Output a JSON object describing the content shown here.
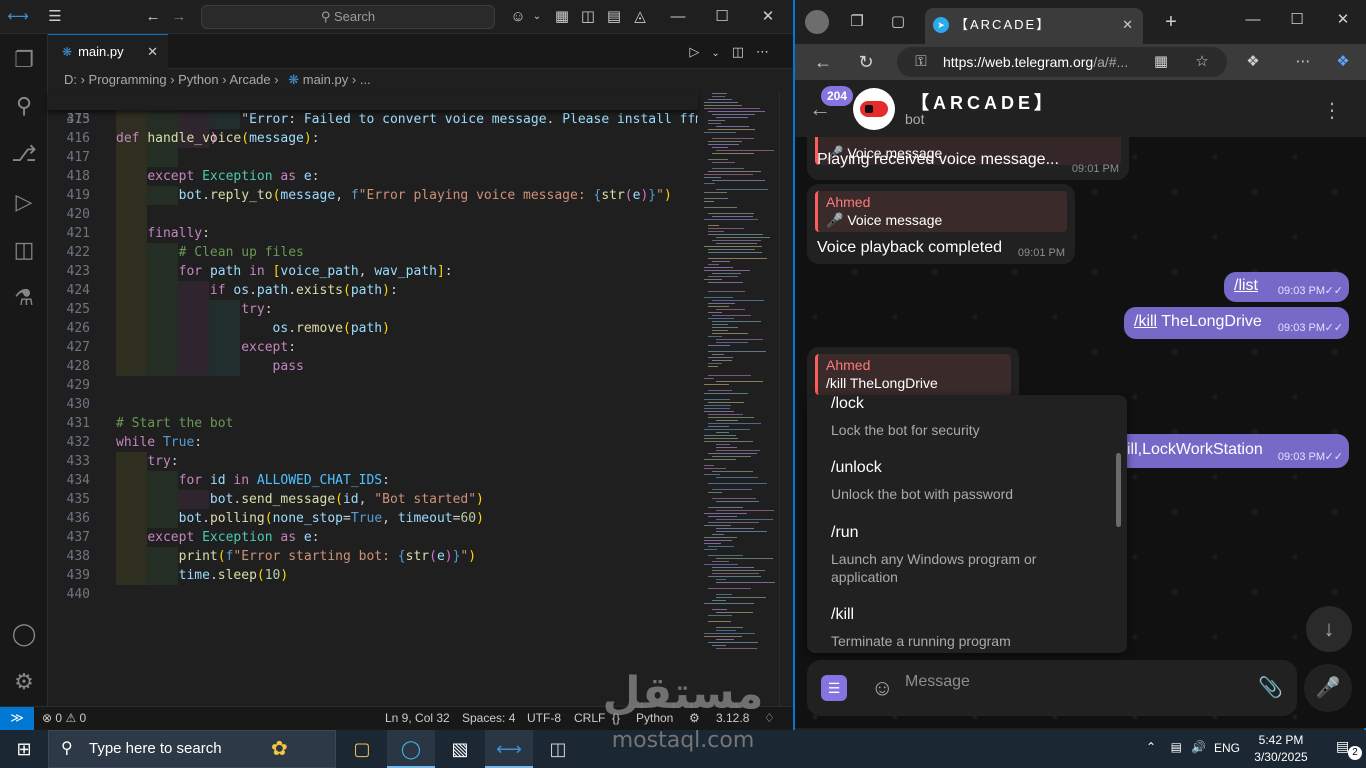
{
  "vscode": {
    "search_placeholder": "Search",
    "tab_label": "main.py",
    "breadcrumb": "D: › Programming › Python › Arcade ›",
    "breadcrumb_file": "main.py",
    "breadcrumb_tail": "› ...",
    "sticky_line": {
      "number": "373",
      "text": "def handle_voice(message):"
    },
    "status": {
      "problems": "0",
      "warnings": "0",
      "cursor": "Ln 9, Col 32",
      "spaces": "Spaces: 4",
      "encoding": "UTF-8",
      "eol": "CRLF",
      "language": "Python",
      "interpreter": "3.12.8"
    },
    "lines": [
      {
        "n": "415",
        "t": "                \"Error: Failed to convert voice message. Please install ffm"
      },
      {
        "n": "416",
        "t": "            )"
      },
      {
        "n": "417",
        "t": ""
      },
      {
        "n": "418",
        "t": "    except Exception as e:"
      },
      {
        "n": "419",
        "t": "        bot.reply_to(message, f\"Error playing voice message: {str(e)}\")"
      },
      {
        "n": "420",
        "t": ""
      },
      {
        "n": "421",
        "t": "    finally:"
      },
      {
        "n": "422",
        "t": "        # Clean up files"
      },
      {
        "n": "423",
        "t": "        for path in [voice_path, wav_path]:"
      },
      {
        "n": "424",
        "t": "            if os.path.exists(path):"
      },
      {
        "n": "425",
        "t": "                try:"
      },
      {
        "n": "426",
        "t": "                    os.remove(path)"
      },
      {
        "n": "427",
        "t": "                except:"
      },
      {
        "n": "428",
        "t": "                    pass"
      },
      {
        "n": "429",
        "t": ""
      },
      {
        "n": "430",
        "t": ""
      },
      {
        "n": "431",
        "t": "# Start the bot"
      },
      {
        "n": "432",
        "t": "while True:"
      },
      {
        "n": "433",
        "t": "    try:"
      },
      {
        "n": "434",
        "t": "        for id in ALLOWED_CHAT_IDS:"
      },
      {
        "n": "435",
        "t": "            bot.send_message(id, \"Bot started\")"
      },
      {
        "n": "436",
        "t": "        bot.polling(none_stop=True, timeout=60)"
      },
      {
        "n": "437",
        "t": "    except Exception as e:"
      },
      {
        "n": "438",
        "t": "        print(f\"Error starting bot: {str(e)}\")"
      },
      {
        "n": "439",
        "t": "        time.sleep(10)"
      },
      {
        "n": "440",
        "t": ""
      }
    ]
  },
  "browser": {
    "tab_title": "【ARCADE】",
    "url_domain": "https://web.telegram.org",
    "url_rest": "/a/#...",
    "chat": {
      "unread_badge": "204",
      "title": "【ARCADE】",
      "subtitle": "bot",
      "messages": [
        {
          "id": "m1",
          "reply_name": "",
          "reply_text": "🎤 Voice message",
          "text": "Playing received voice message...",
          "time": "09:01 PM"
        },
        {
          "id": "m2",
          "reply_name": "Ahmed",
          "reply_text": "🎤 Voice message",
          "text": "Voice playback completed",
          "time": "09:01 PM"
        },
        {
          "id": "m3",
          "text": "/list",
          "time": "09:03 PM"
        },
        {
          "id": "m4",
          "cmd": "/kill",
          "text": " TheLongDrive",
          "time": "09:03 PM"
        },
        {
          "id": "m5",
          "reply_name": "Ahmed",
          "reply_text": "/kill TheLongDrive"
        },
        {
          "id": "m6",
          "text": "ill,LockWorkStation",
          "time": "09:03 PM"
        }
      ],
      "commands": [
        {
          "name": "/lock",
          "desc": "Lock the bot for security"
        },
        {
          "name": "/unlock",
          "desc": "Unlock the bot with password"
        },
        {
          "name": "/run",
          "desc": "Launch any Windows program or application"
        },
        {
          "name": "/kill",
          "desc": "Terminate a running program"
        }
      ],
      "composer_placeholder": "Message"
    }
  },
  "taskbar": {
    "search_placeholder": "Type here to search",
    "language": "ENG",
    "time": "5:42 PM",
    "date": "3/30/2025",
    "notifications": "2"
  },
  "watermark": {
    "arabic": "مستقل",
    "latin": "mostaql.com"
  }
}
